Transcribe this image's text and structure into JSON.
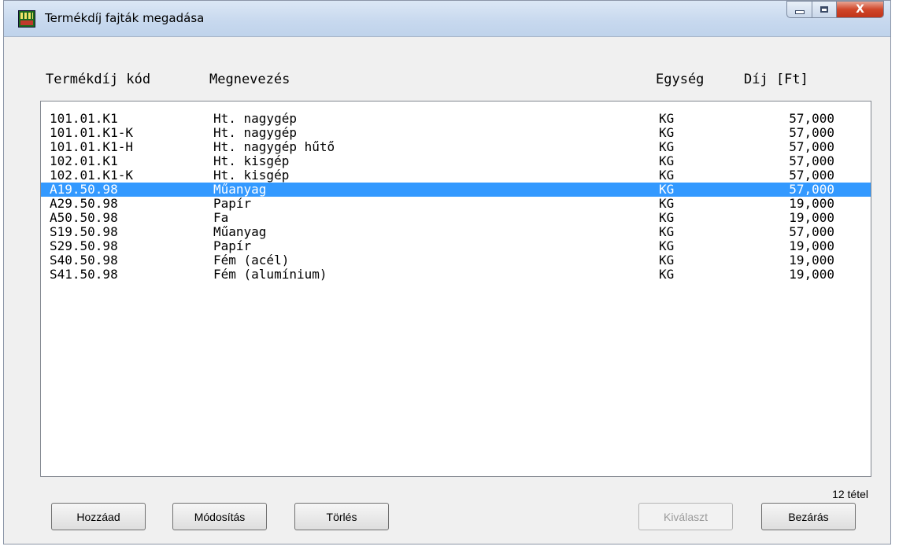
{
  "window": {
    "title": "Termékdíj fajták megadása",
    "close_glyph": "X"
  },
  "columns": {
    "code": "Termékdíj kód",
    "name": "Megnevezés",
    "unit": "Egység",
    "fee": "Díj [Ft]"
  },
  "rows": [
    {
      "code": "101.01.K1",
      "name": "Ht. nagygép",
      "unit": "KG",
      "fee": "57,000"
    },
    {
      "code": "101.01.K1-K",
      "name": "Ht. nagygép",
      "unit": "KG",
      "fee": "57,000"
    },
    {
      "code": "101.01.K1-H",
      "name": "Ht. nagygép hűtő",
      "unit": "KG",
      "fee": "57,000"
    },
    {
      "code": "102.01.K1",
      "name": "Ht. kisgép",
      "unit": "KG",
      "fee": "57,000"
    },
    {
      "code": "102.01.K1-K",
      "name": "Ht. kisgép",
      "unit": "KG",
      "fee": "57,000"
    },
    {
      "code": "A19.50.98",
      "name": "Műanyag",
      "unit": "KG",
      "fee": "57,000",
      "selected": true
    },
    {
      "code": "A29.50.98",
      "name": "Papír",
      "unit": "KG",
      "fee": "19,000"
    },
    {
      "code": "A50.50.98",
      "name": "Fa",
      "unit": "KG",
      "fee": "19,000"
    },
    {
      "code": "S19.50.98",
      "name": "Műanyag",
      "unit": "KG",
      "fee": "57,000"
    },
    {
      "code": "S29.50.98",
      "name": "Papír",
      "unit": "KG",
      "fee": "19,000"
    },
    {
      "code": "S40.50.98",
      "name": "Fém (acél)",
      "unit": "KG",
      "fee": "19,000"
    },
    {
      "code": "S41.50.98",
      "name": "Fém (alumínium)",
      "unit": "KG",
      "fee": "19,000"
    }
  ],
  "count_label": "12 tétel",
  "buttons": {
    "add": "Hozzáad",
    "modify": "Módosítás",
    "delete": "Törlés",
    "select": "Kiválaszt",
    "close": "Bezárás"
  },
  "icons": {
    "app": "app-icon",
    "minimize": "minimize-icon",
    "maximize": "maximize-icon",
    "close": "close-icon"
  },
  "colors": {
    "selection": "#3399ff",
    "close_button": "#d0472a",
    "window_bg": "#f0f0f0"
  }
}
